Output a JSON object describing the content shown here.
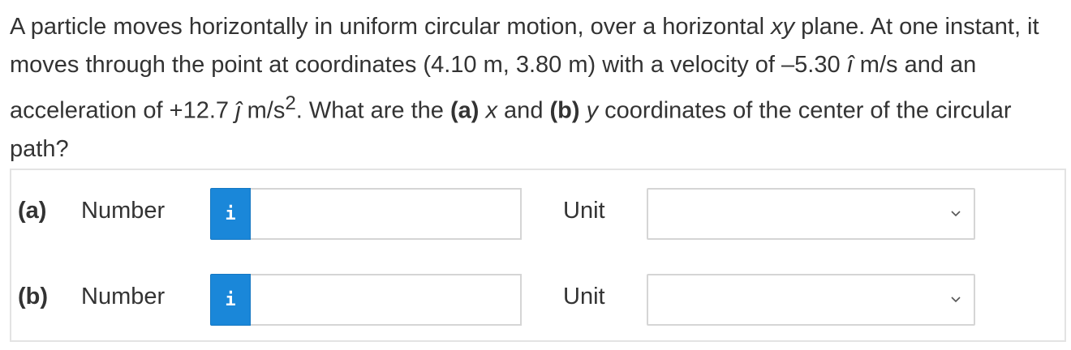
{
  "question": {
    "t1": "A particle moves horizontally in uniform circular motion, over a horizontal ",
    "t1_var": "xy",
    "t2": " plane. At one instant, it moves through the point at coordinates (4.10 m, 3.80 m) with a velocity of –5.30 ",
    "i_hat": "î",
    "t3": " m/s and an acceleration of +12.7 ",
    "j_hat": "ĵ",
    "t4": " m/s",
    "t4_sup": "2",
    "t5": ". What are the ",
    "part_a": "(a)",
    "x_var": "x",
    "t6": " and ",
    "part_b": "(b)",
    "y_var": "y",
    "t7": " coordinates of the center of the circular path?"
  },
  "rows": [
    {
      "part": "(a)",
      "number_label": "Number",
      "info_glyph": "i",
      "number_value": "",
      "unit_label": "Unit",
      "unit_value": ""
    },
    {
      "part": "(b)",
      "number_label": "Number",
      "info_glyph": "i",
      "number_value": "",
      "unit_label": "Unit",
      "unit_value": ""
    }
  ],
  "icons": {
    "info": "info-icon",
    "dropdown": "chevron-down-icon"
  },
  "colors": {
    "info_button": "#1a87d9",
    "text": "#333333",
    "border": "#d5d5d5"
  }
}
